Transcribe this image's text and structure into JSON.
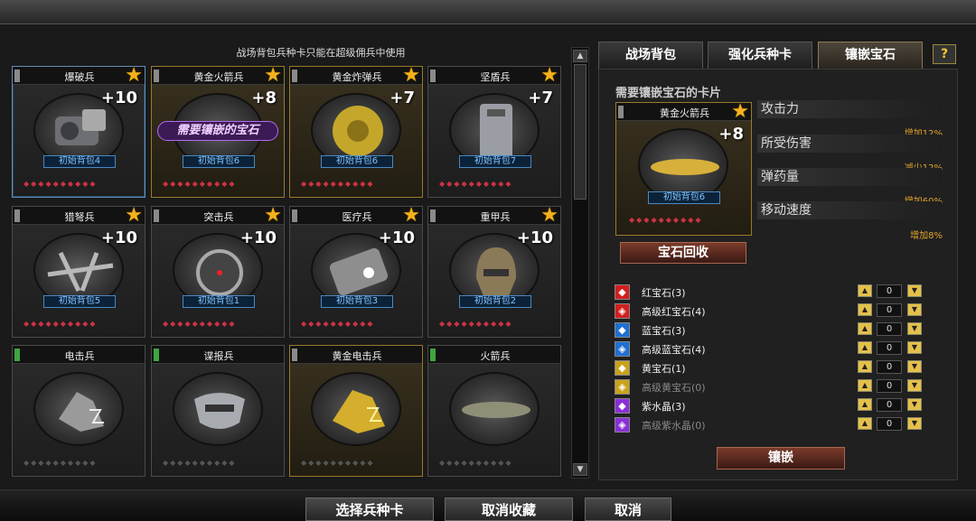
{
  "notice": "战场背包兵种卡只能在超级佣兵中使用",
  "cards": [
    {
      "name": "爆破兵",
      "plus": "+10",
      "bag": "初始背包4"
    },
    {
      "name": "黄金火箭兵",
      "plus": "+8",
      "bag": "初始背包6",
      "banner": "需要镶嵌的宝石"
    },
    {
      "name": "黄金炸弹兵",
      "plus": "+7",
      "bag": "初始背包6"
    },
    {
      "name": "坚盾兵",
      "plus": "+7",
      "bag": "初始背包7"
    },
    {
      "name": "猎弩兵",
      "plus": "+10",
      "bag": "初始背包5"
    },
    {
      "name": "突击兵",
      "plus": "+10",
      "bag": "初始背包1"
    },
    {
      "name": "医疗兵",
      "plus": "+10",
      "bag": "初始背包3"
    },
    {
      "name": "重甲兵",
      "plus": "+10",
      "bag": "初始背包2"
    },
    {
      "name": "电击兵"
    },
    {
      "name": "谍报兵"
    },
    {
      "name": "黄金电击兵"
    },
    {
      "name": "火箭兵"
    }
  ],
  "gem_strip": "◆◆◆◆◆◆◆◆◆◆",
  "tabs": [
    "战场背包",
    "强化兵种卡",
    "镶嵌宝石"
  ],
  "help": "?",
  "need_label": "需要镶嵌宝石的卡片",
  "selected_card": {
    "name": "黄金火箭兵",
    "plus": "+8",
    "bag": "初始背包6"
  },
  "stats": [
    {
      "label": "攻击力",
      "value": "增加12%"
    },
    {
      "label": "所受伤害",
      "value": "减少12%"
    },
    {
      "label": "弹药量",
      "value": "增加60%"
    },
    {
      "label": "移动速度",
      "value": "增加8%"
    }
  ],
  "recycle_label": "宝石回收",
  "gems": [
    {
      "name": "红宝石(3)",
      "count": "0",
      "color": "#d21f1f"
    },
    {
      "name": "高级红宝石(4)",
      "count": "0",
      "color": "#d21f1f"
    },
    {
      "name": "蓝宝石(3)",
      "count": "0",
      "color": "#1f6fd2"
    },
    {
      "name": "高级蓝宝石(4)",
      "count": "0",
      "color": "#1f6fd2"
    },
    {
      "name": "黄宝石(1)",
      "count": "0",
      "color": "#c9a21a"
    },
    {
      "name": "高级黄宝石(0)",
      "count": "0",
      "color": "#c9a21a"
    },
    {
      "name": "紫水晶(3)",
      "count": "0",
      "color": "#8a2fd6"
    },
    {
      "name": "高级紫水晶(0)",
      "count": "0",
      "color": "#8a2fd6"
    }
  ],
  "embed_label": "镶嵌",
  "bottom_buttons": [
    "选择兵种卡",
    "取消收藏",
    "取消"
  ]
}
